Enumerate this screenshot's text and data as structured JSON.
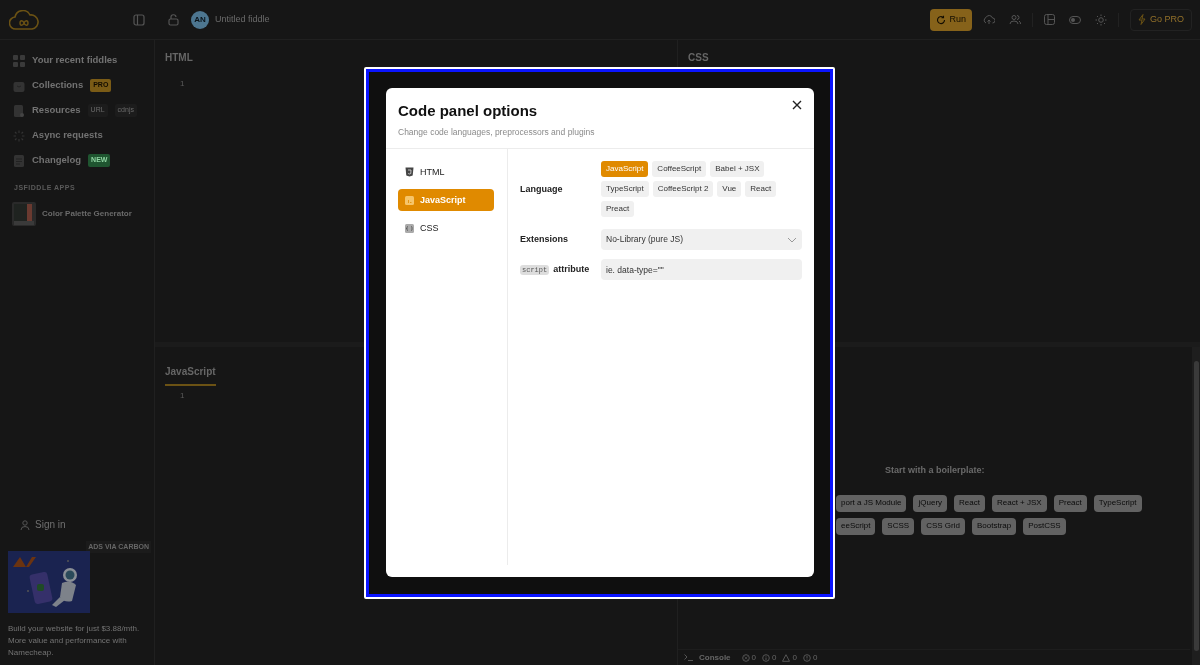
{
  "topbar": {
    "avatar": "AN",
    "title": "Untitled fiddle",
    "run": "Run",
    "go_pro": "Go PRO"
  },
  "sidebar": {
    "items": [
      {
        "label": "Your recent fiddles"
      },
      {
        "label": "Collections",
        "badges": [
          {
            "text": "PRO",
            "kind": "pro"
          }
        ]
      },
      {
        "label": "Resources",
        "badges": [
          {
            "text": "URL",
            "kind": "plain"
          },
          {
            "text": "cdnjs",
            "kind": "plain"
          }
        ]
      },
      {
        "label": "Async requests"
      },
      {
        "label": "Changelog",
        "badges": [
          {
            "text": "NEW",
            "kind": "new"
          }
        ]
      }
    ],
    "apps_heading": "JSFIDDLE APPS",
    "apps": [
      {
        "name": "Color Palette Generator"
      }
    ],
    "sign_in": "Sign in",
    "ad": {
      "label": "ADS VIA CARBON",
      "text": "Build your website for just $3.88/mth. More value and performance with Namecheap."
    }
  },
  "panels": {
    "html": {
      "title": "HTML",
      "line_numbers": [
        "1"
      ]
    },
    "css": {
      "title": "CSS"
    },
    "js": {
      "title": "JavaScript",
      "line_numbers": [
        "1"
      ],
      "selected": true
    }
  },
  "result": {
    "heading": "Start with a boilerplate:",
    "boilerplates": [
      "port a JS Module",
      "jQuery",
      "React",
      "React + JSX",
      "Preact",
      "TypeScript",
      "eeScript",
      "SCSS",
      "CSS Grid",
      "Bootstrap",
      "PostCSS"
    ],
    "console": {
      "label": "Console",
      "counts": [
        "0",
        "0",
        "0",
        "0"
      ]
    }
  },
  "modal": {
    "title": "Code panel options",
    "subtitle": "Change code languages, preprocessors and plugins",
    "nav": [
      {
        "label": "HTML",
        "selected": false
      },
      {
        "label": "JavaScript",
        "selected": true
      },
      {
        "label": "CSS",
        "selected": false
      }
    ],
    "language": {
      "label": "Language",
      "options": [
        {
          "label": "JavaScript",
          "selected": true
        },
        {
          "label": "CoffeeScript",
          "selected": false
        },
        {
          "label": "Babel + JSX",
          "selected": false
        },
        {
          "label": "TypeScript",
          "selected": false
        },
        {
          "label": "CoffeeScript 2",
          "selected": false
        },
        {
          "label": "Vue",
          "selected": false
        },
        {
          "label": "React",
          "selected": false
        },
        {
          "label": "Preact",
          "selected": false
        }
      ]
    },
    "extensions": {
      "label": "Extensions",
      "value": "No-Library (pure JS)"
    },
    "attribute": {
      "code": "script",
      "label": "attribute",
      "placeholder": "ie. data-type=\"\""
    }
  }
}
